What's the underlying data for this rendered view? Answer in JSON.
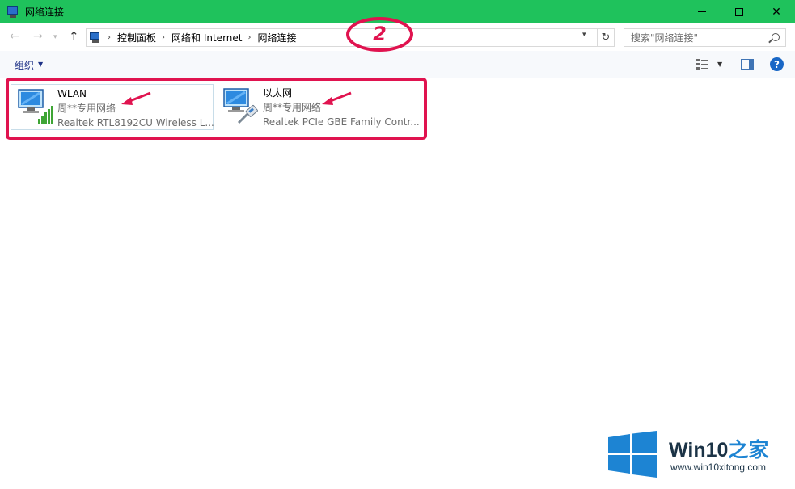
{
  "window": {
    "title": "网络连接"
  },
  "address": {
    "crumbs": [
      "控制面板",
      "网络和 Internet",
      "网络连接"
    ]
  },
  "search": {
    "placeholder": "搜索\"网络连接\""
  },
  "toolbar": {
    "organize_label": "组织"
  },
  "adapters": [
    {
      "name": "WLAN",
      "status": "周**专用网络",
      "device": "Realtek RTL8192CU Wireless L...",
      "type": "wireless"
    },
    {
      "name": "以太网",
      "status": "周**专用网络",
      "device": "Realtek PCIe GBE Family Contr...",
      "type": "ethernet"
    }
  ],
  "annotation": {
    "step_number": "2",
    "color": "#e0134f"
  },
  "watermark": {
    "brand": "Win10",
    "brand_suffix": "之家",
    "url": "www.win10xitong.com"
  },
  "colors": {
    "titlebar": "#1fc25c",
    "accent": "#1967c6"
  }
}
